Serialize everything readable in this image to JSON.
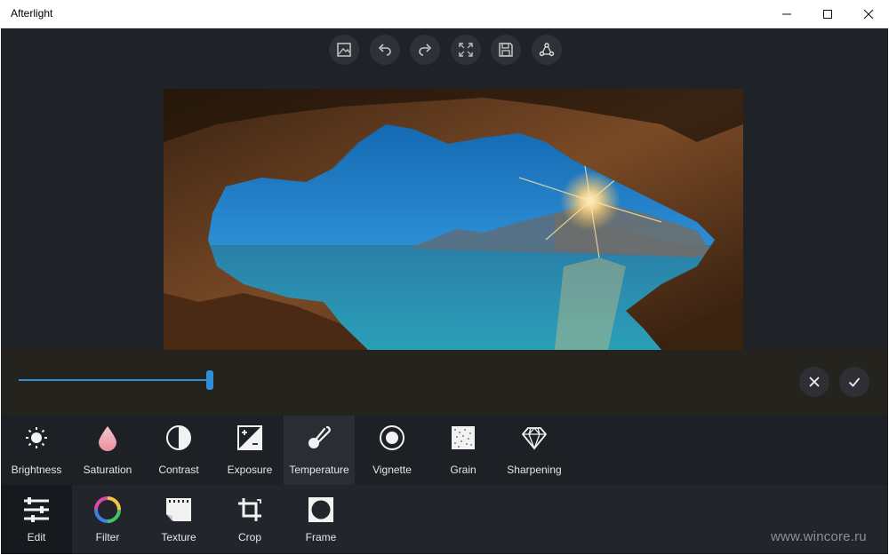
{
  "window": {
    "title": "Afterlight",
    "controls": [
      "minimize-icon",
      "maximize-icon",
      "close-icon"
    ]
  },
  "toolbar": {
    "buttons": [
      {
        "name": "compare",
        "icon": "image-compare-icon"
      },
      {
        "name": "undo",
        "icon": "undo-icon"
      },
      {
        "name": "redo",
        "icon": "redo-icon"
      },
      {
        "name": "fullscreen",
        "icon": "expand-icon"
      },
      {
        "name": "save",
        "icon": "save-icon"
      },
      {
        "name": "share",
        "icon": "share-icon"
      }
    ]
  },
  "slider": {
    "value_fraction": 0.23,
    "accent": "#2f8fd8"
  },
  "actions": {
    "cancel_icon": "close-icon",
    "apply_icon": "check-icon"
  },
  "adjust_tools": [
    {
      "label": "Brightness",
      "icon": "sun-icon"
    },
    {
      "label": "Saturation",
      "icon": "drop-icon"
    },
    {
      "label": "Contrast",
      "icon": "contrast-icon"
    },
    {
      "label": "Exposure",
      "icon": "exposure-icon"
    },
    {
      "label": "Temperature",
      "icon": "thermometer-icon",
      "active": true
    },
    {
      "label": "Vignette",
      "icon": "vignette-icon"
    },
    {
      "label": "Grain",
      "icon": "grain-icon"
    },
    {
      "label": "Sharpening",
      "icon": "diamond-icon"
    }
  ],
  "nav": [
    {
      "label": "Edit",
      "icon": "sliders-icon",
      "active": true
    },
    {
      "label": "Filter",
      "icon": "color-ring-icon"
    },
    {
      "label": "Texture",
      "icon": "film-icon"
    },
    {
      "label": "Crop",
      "icon": "crop-icon"
    },
    {
      "label": "Frame",
      "icon": "frame-icon"
    }
  ],
  "watermark": "www.wincore.ru"
}
